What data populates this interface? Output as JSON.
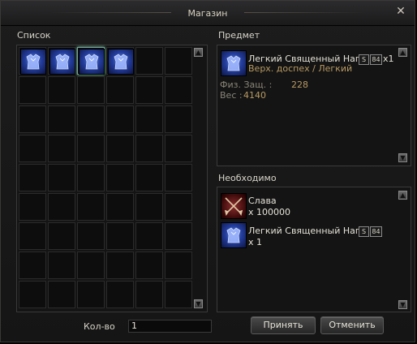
{
  "window": {
    "title": "Магазин",
    "close_glyph": "✕"
  },
  "list": {
    "label": "Список",
    "items": [
      {
        "icon": "armor-icon"
      },
      {
        "icon": "armor-icon"
      },
      {
        "icon": "armor-icon"
      },
      {
        "icon": "armor-icon"
      }
    ]
  },
  "product": {
    "label": "Предмет",
    "name": "Легкий Священный Наг..",
    "grade": "S",
    "level": "84",
    "count": "x1",
    "type": "Верх. доспех / Легкий",
    "stat1_label": "Физ. Защ. :",
    "stat1_value": "228",
    "stat2_label": "Вес :",
    "stat2_value": "4140"
  },
  "required": {
    "label": "Необходимо",
    "items": [
      {
        "icon": "crossed-swords-icon",
        "name": "Слава",
        "qty": "x 100000"
      },
      {
        "icon": "armor-icon",
        "name": "Легкий Священный Наг..",
        "grade": "S",
        "level": "84",
        "qty": "x 1"
      }
    ]
  },
  "footer": {
    "qty_label": "Кол-во",
    "qty_value": "1",
    "accept_label": "Принять",
    "cancel_label": "Отменить"
  },
  "colors": {
    "accent": "#b89a62",
    "armor": "#2a4aa8"
  }
}
